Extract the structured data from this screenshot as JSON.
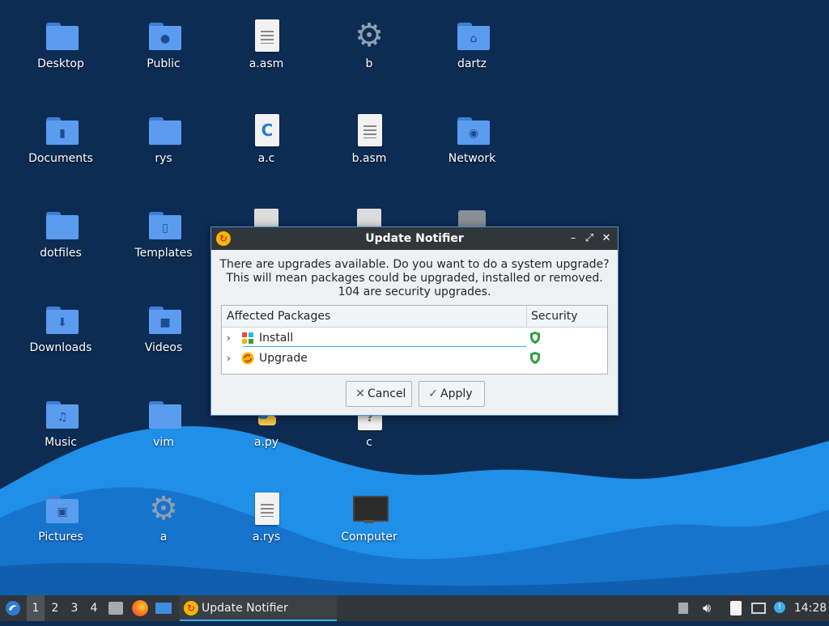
{
  "desktop": {
    "icons": [
      {
        "label": "Desktop",
        "kind": "folder",
        "emblem": ""
      },
      {
        "label": "Public",
        "kind": "folder",
        "emblem": "person"
      },
      {
        "label": "a.asm",
        "kind": "text-file",
        "emblem": ""
      },
      {
        "label": "b",
        "kind": "gear",
        "emblem": ""
      },
      {
        "label": "dartz",
        "kind": "folder",
        "emblem": "home"
      },
      {
        "label": "Documents",
        "kind": "folder",
        "emblem": "document"
      },
      {
        "label": "rys",
        "kind": "folder",
        "emblem": ""
      },
      {
        "label": "a.c",
        "kind": "c-source",
        "emblem": "C"
      },
      {
        "label": "b.asm",
        "kind": "text-file",
        "emblem": ""
      },
      {
        "label": "Network",
        "kind": "folder",
        "emblem": "globe"
      },
      {
        "label": "dotfiles",
        "kind": "folder",
        "emblem": ""
      },
      {
        "label": "Templates",
        "kind": "folder",
        "emblem": "template"
      },
      {
        "label": "Downloads",
        "kind": "folder",
        "emblem": "download"
      },
      {
        "label": "Videos",
        "kind": "folder",
        "emblem": "camera"
      },
      {
        "label": "Music",
        "kind": "folder",
        "emblem": "music"
      },
      {
        "label": "vim",
        "kind": "folder",
        "emblem": ""
      },
      {
        "label": "a.py",
        "kind": "python-file",
        "emblem": ""
      },
      {
        "label": "c",
        "kind": "unknown-file",
        "emblem": "?"
      },
      {
        "label": "Pictures",
        "kind": "folder",
        "emblem": "image"
      },
      {
        "label": "a",
        "kind": "gear",
        "emblem": ""
      },
      {
        "label": "a.rys",
        "kind": "text-file",
        "emblem": ""
      },
      {
        "label": "Computer",
        "kind": "monitor",
        "emblem": ""
      }
    ]
  },
  "dialog": {
    "title": "Update Notifier",
    "message_lines": [
      "There are upgrades available. Do you want to do a system upgrade?",
      "This will mean packages could be upgraded, installed or removed.",
      "104 are security upgrades."
    ],
    "table": {
      "col_packages": "Affected Packages",
      "col_security": "Security",
      "rows": [
        {
          "name": "Install",
          "icon": "package-grid-icon"
        },
        {
          "name": "Upgrade",
          "icon": "update-icon"
        }
      ]
    },
    "cancel_label": "Cancel",
    "apply_label": "Apply"
  },
  "taskbar": {
    "workspaces": [
      "1",
      "2",
      "3",
      "4"
    ],
    "active_task": "Update Notifier",
    "clock": "14:28"
  },
  "colors": {
    "wallpaper_dark": "#0d2c54",
    "wave_light": "#1e90ff",
    "taskbar": "#31363b",
    "accent": "#3daee9",
    "shield": "#2ea043"
  }
}
